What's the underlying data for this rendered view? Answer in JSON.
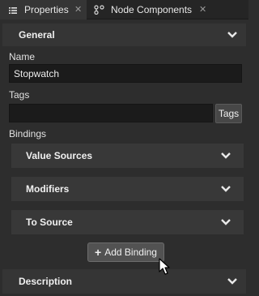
{
  "tabs": [
    {
      "label": "Properties",
      "icon": "list-icon",
      "active": true
    },
    {
      "label": "Node Components",
      "icon": "node-components-icon",
      "active": false
    }
  ],
  "sections": {
    "general": "General",
    "description": "Description"
  },
  "fields": {
    "name_label": "Name",
    "name_value": "Stopwatch",
    "tags_label": "Tags",
    "tags_value": "",
    "tags_button": "Tags",
    "bindings_label": "Bindings"
  },
  "bindings": [
    {
      "label": "Value Sources"
    },
    {
      "label": "Modifiers"
    },
    {
      "label": "To Source"
    }
  ],
  "add_binding": {
    "icon": "plus-icon",
    "label": "Add Binding"
  },
  "colors": {
    "background": "#2d2d2d",
    "section": "#353535",
    "field": "#1b1b1b",
    "button": "#525252"
  }
}
